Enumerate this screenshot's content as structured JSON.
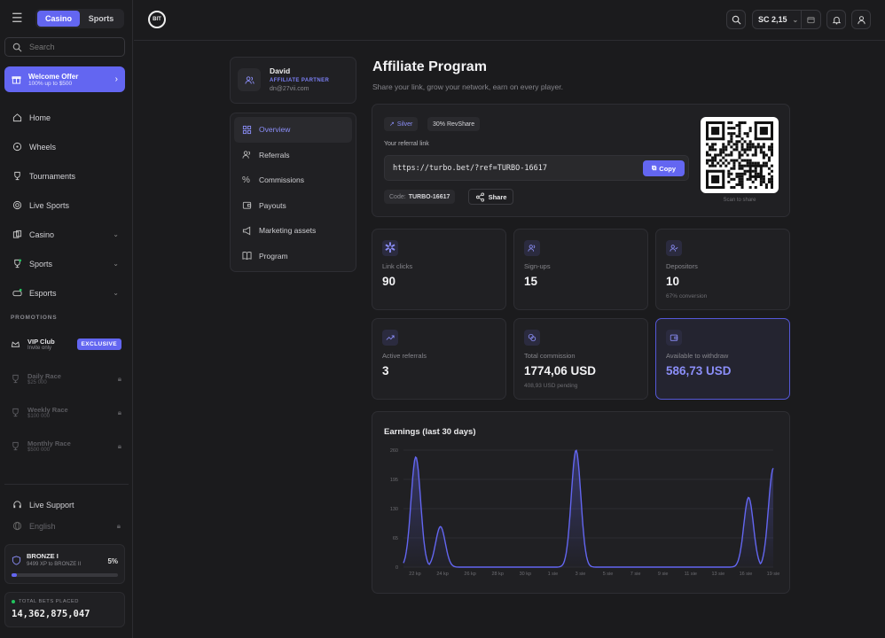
{
  "sidebar": {
    "segment": [
      "Casino",
      "Sports"
    ],
    "search_placeholder": "Search",
    "welcome": {
      "title": "Welcome Offer",
      "subtitle": "100% up to $500"
    },
    "nav": [
      {
        "label": "Home",
        "icon": "home-icon"
      },
      {
        "label": "Wheels",
        "icon": "wheel-icon"
      },
      {
        "label": "Tournaments",
        "icon": "trophy-icon"
      },
      {
        "label": "Live Sports",
        "icon": "live-icon"
      },
      {
        "label": "Casino",
        "icon": "casino-icon"
      },
      {
        "label": "Sports",
        "icon": "sports-icon"
      },
      {
        "label": "Esports",
        "icon": "esports-icon"
      }
    ],
    "promotions_heading": "PROMOTIONS",
    "promos": [
      {
        "title": "VIP Club",
        "subtitle": "Invite only",
        "badge": "EXCLUSIVE"
      },
      {
        "title": "Daily Race",
        "subtitle": "$25 000"
      },
      {
        "title": "Weekly Race",
        "subtitle": "$100 000"
      },
      {
        "title": "Monthly Race",
        "subtitle": "$500 000"
      }
    ],
    "support": "Live Support",
    "language": "English",
    "rank": {
      "title": "BRONZE I",
      "subtitle": "9499 XP to BRONZE II",
      "percent_label": "5%",
      "progress": 0.05
    },
    "total": {
      "label": "TOTAL BETS PLACED",
      "value": "14,362,875,047"
    }
  },
  "topbar": {
    "logo": "BIT",
    "balance": "SC 2,15"
  },
  "profile": {
    "name": "David",
    "role": "AFFILIATE PARTNER",
    "email": "dn@27vii.com"
  },
  "menu": [
    "Overview",
    "Referrals",
    "Commissions",
    "Payouts",
    "Marketing assets",
    "Program"
  ],
  "page": {
    "title": "Affiliate Program",
    "subtitle": "Share your link, grow your network, earn on every player."
  },
  "referral": {
    "tier": "Silver",
    "revshare": "30% RevShare",
    "link_label": "Your referral link",
    "link": "https://turbo.bet/?ref=TURBO-16617",
    "copy": "Copy",
    "code_label": "Code:",
    "code": "TURBO-16617",
    "share": "Share",
    "qr_caption": "Scan to share"
  },
  "stats": [
    {
      "label": "Link clicks",
      "value": "90",
      "sub": ""
    },
    {
      "label": "Sign-ups",
      "value": "15",
      "sub": ""
    },
    {
      "label": "Depositors",
      "value": "10",
      "sub": "67% conversion"
    },
    {
      "label": "Active referrals",
      "value": "3",
      "sub": ""
    },
    {
      "label": "Total commission",
      "value": "1774,06 USD",
      "sub": "408,93 USD pending"
    },
    {
      "label": "Available to withdraw",
      "value": "586,73 USD",
      "sub": ""
    }
  ],
  "colors": {
    "accent": "#6366f1",
    "accent_text": "#8b8ef8",
    "bg": "#1b1b1d",
    "card": "#202023"
  },
  "chart_data": {
    "type": "area",
    "title": "Earnings (last 30 days)",
    "ylim": [
      0,
      260
    ],
    "yticks": [
      "0",
      "65",
      "130",
      "195",
      "260"
    ],
    "xticks": [
      "22 kp",
      "24 kp",
      "26 kp",
      "28 kp",
      "30 kp",
      "1 sie",
      "3 sie",
      "5 sie",
      "7 sie",
      "9 sie",
      "11 sie",
      "13 sie",
      "16 sie",
      "19 sie"
    ],
    "series": [
      {
        "values": [
          0,
          245,
          0,
          90,
          0,
          0,
          0,
          0,
          0,
          0,
          0,
          0,
          0,
          0,
          260,
          0,
          0,
          0,
          0,
          0,
          0,
          0,
          0,
          0,
          0,
          0,
          0,
          0,
          155,
          0,
          220
        ]
      }
    ]
  }
}
